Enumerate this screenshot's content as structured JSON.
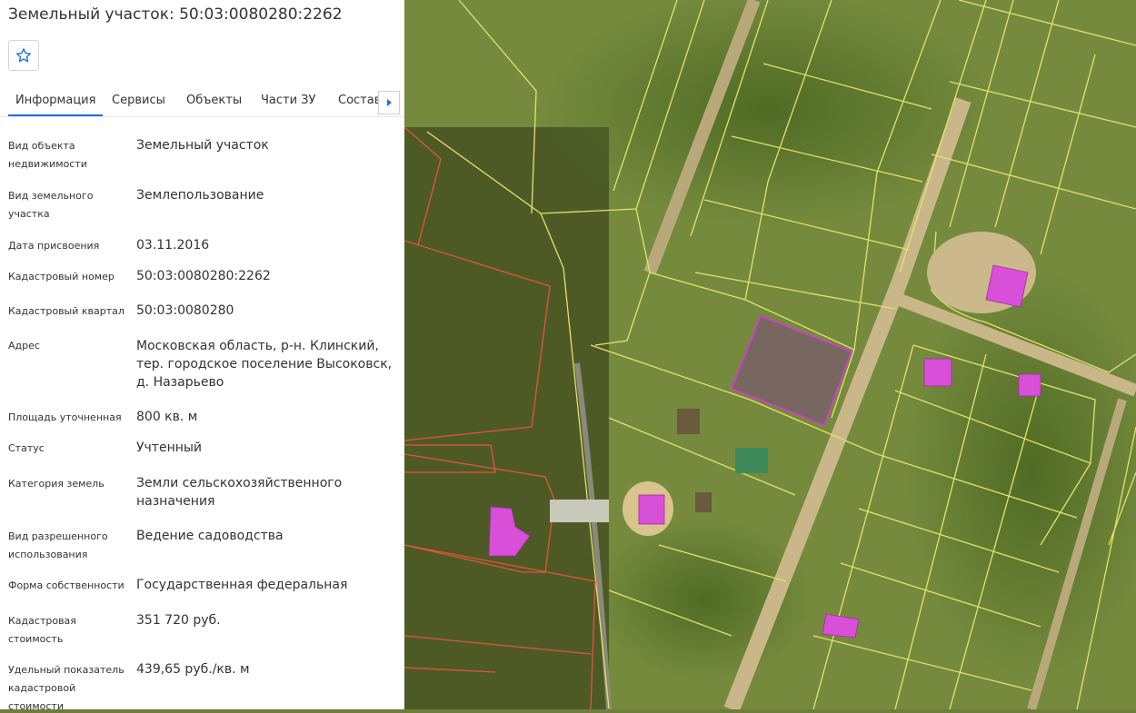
{
  "title": "Земельный участок: 50:03:0080280:2262",
  "favorite": {
    "icon": "star-outline-icon"
  },
  "tabs": [
    {
      "label": "Информация",
      "active": true
    },
    {
      "label": "Сервисы"
    },
    {
      "label": "Объекты"
    },
    {
      "label": "Части ЗУ"
    },
    {
      "label": "Состав"
    }
  ],
  "tabs_scroll": {
    "icon": "chevron-right-icon"
  },
  "info": {
    "object_type": {
      "label": "Вид объекта недвижимости",
      "value": "Земельный участок"
    },
    "land_type": {
      "label": "Вид земельного участка",
      "value": "Землепользование"
    },
    "assigned_date": {
      "label": "Дата присвоения",
      "value": "03.11.2016"
    },
    "cadastral_number": {
      "label": "Кадастровый номер",
      "value": "50:03:0080280:2262"
    },
    "cadastral_quarter": {
      "label": "Кадастровый квартал",
      "value": "50:03:0080280"
    },
    "address": {
      "label": "Адрес",
      "value": "Московская область, р-н. Клинский, тер. городское поселение Высоковск, д. Назарьево"
    },
    "area": {
      "label": "Площадь уточненная",
      "value": "800 кв. м"
    },
    "status": {
      "label": "Статус",
      "value": "Учтенный"
    },
    "land_category": {
      "label": "Категория земель",
      "value": "Земли сельскохозяйственного назначения"
    },
    "permitted_use": {
      "label": "Вид разрешенного использования",
      "value": "Ведение садоводства"
    },
    "ownership": {
      "label": "Форма собственности",
      "value": "Государственная федеральная"
    },
    "cadastral_value": {
      "label": "Кадастровая стоимость",
      "value": "351 720 руб."
    },
    "specific_value": {
      "label": "Удельный показатель кадастровой стоимости",
      "value": "439,65 руб./кв. м"
    }
  },
  "colors": {
    "accent": "#1e6fd9",
    "parcel_lines": "#e3e36a",
    "parcel_red": "#e0563a",
    "selected_parcel": "#d33bd3",
    "building": "#d84fd8"
  }
}
